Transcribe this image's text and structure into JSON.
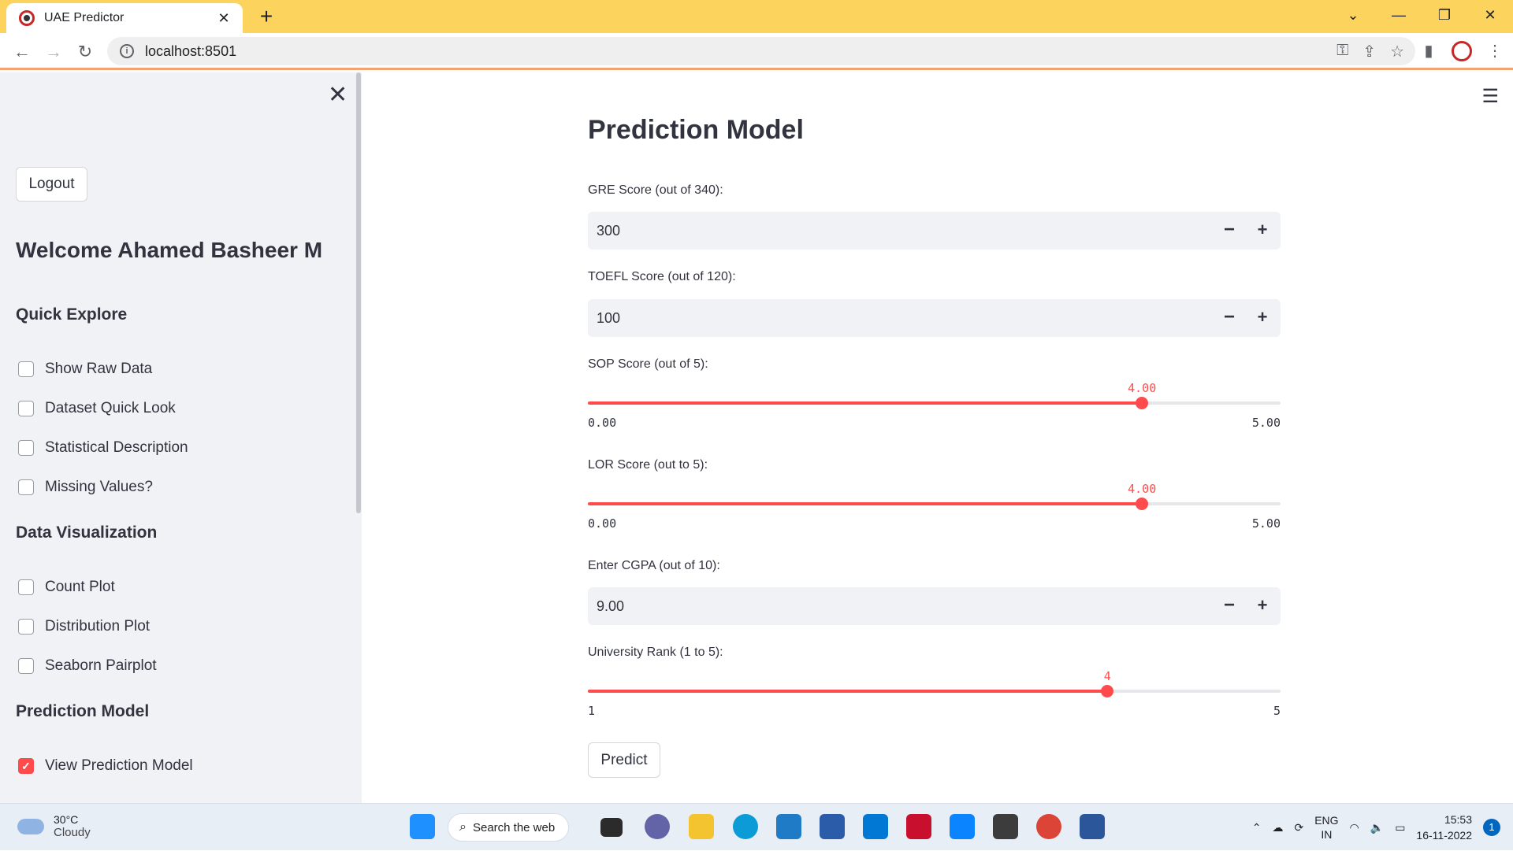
{
  "browser": {
    "tab_title": "UAE Predictor",
    "url": "localhost:8501"
  },
  "sidebar": {
    "logout_label": "Logout",
    "welcome": "Welcome Ahamed Basheer M",
    "sections": [
      {
        "title": "Quick Explore",
        "items": [
          {
            "label": "Show Raw Data",
            "checked": false
          },
          {
            "label": "Dataset Quick Look",
            "checked": false
          },
          {
            "label": "Statistical Description",
            "checked": false
          },
          {
            "label": "Missing Values?",
            "checked": false
          }
        ]
      },
      {
        "title": "Data Visualization",
        "items": [
          {
            "label": "Count Plot",
            "checked": false
          },
          {
            "label": "Distribution Plot",
            "checked": false
          },
          {
            "label": "Seaborn Pairplot",
            "checked": false
          }
        ]
      },
      {
        "title": "Prediction Model",
        "items": [
          {
            "label": "View Prediction Model",
            "checked": true
          }
        ]
      }
    ]
  },
  "main": {
    "title": "Prediction Model",
    "gre": {
      "label": "GRE Score (out of 340):",
      "value": "300",
      "minus": "−",
      "plus": "+"
    },
    "toefl": {
      "label": "TOEFL Score (out of 120):",
      "value": "100",
      "minus": "−",
      "plus": "+"
    },
    "sop": {
      "label": "SOP Score (out of 5):",
      "value": 4.0,
      "value_text": "4.00",
      "min": 0,
      "max": 5,
      "min_text": "0.00",
      "max_text": "5.00"
    },
    "lor": {
      "label": "LOR Score (out to 5):",
      "value": 4.0,
      "value_text": "4.00",
      "min": 0,
      "max": 5,
      "min_text": "0.00",
      "max_text": "5.00"
    },
    "cgpa": {
      "label": "Enter CGPA (out of 10):",
      "value": "9.00",
      "minus": "−",
      "plus": "+"
    },
    "rank": {
      "label": "University Rank (1 to 5):",
      "value": 4,
      "value_text": "4",
      "min": 1,
      "max": 5,
      "min_text": "1",
      "max_text": "5"
    },
    "predict_label": "Predict"
  },
  "taskbar": {
    "temperature": "30°C",
    "condition": "Cloudy",
    "search_label": "Search the web",
    "lang_top": "ENG",
    "lang_bottom": "IN",
    "time": "15:53",
    "date": "16-11-2022",
    "notifications": "1"
  },
  "colors": {
    "accent": "#ff4b4b",
    "chrome": "#fcd35c",
    "sidebar": "#f0f2f6"
  }
}
